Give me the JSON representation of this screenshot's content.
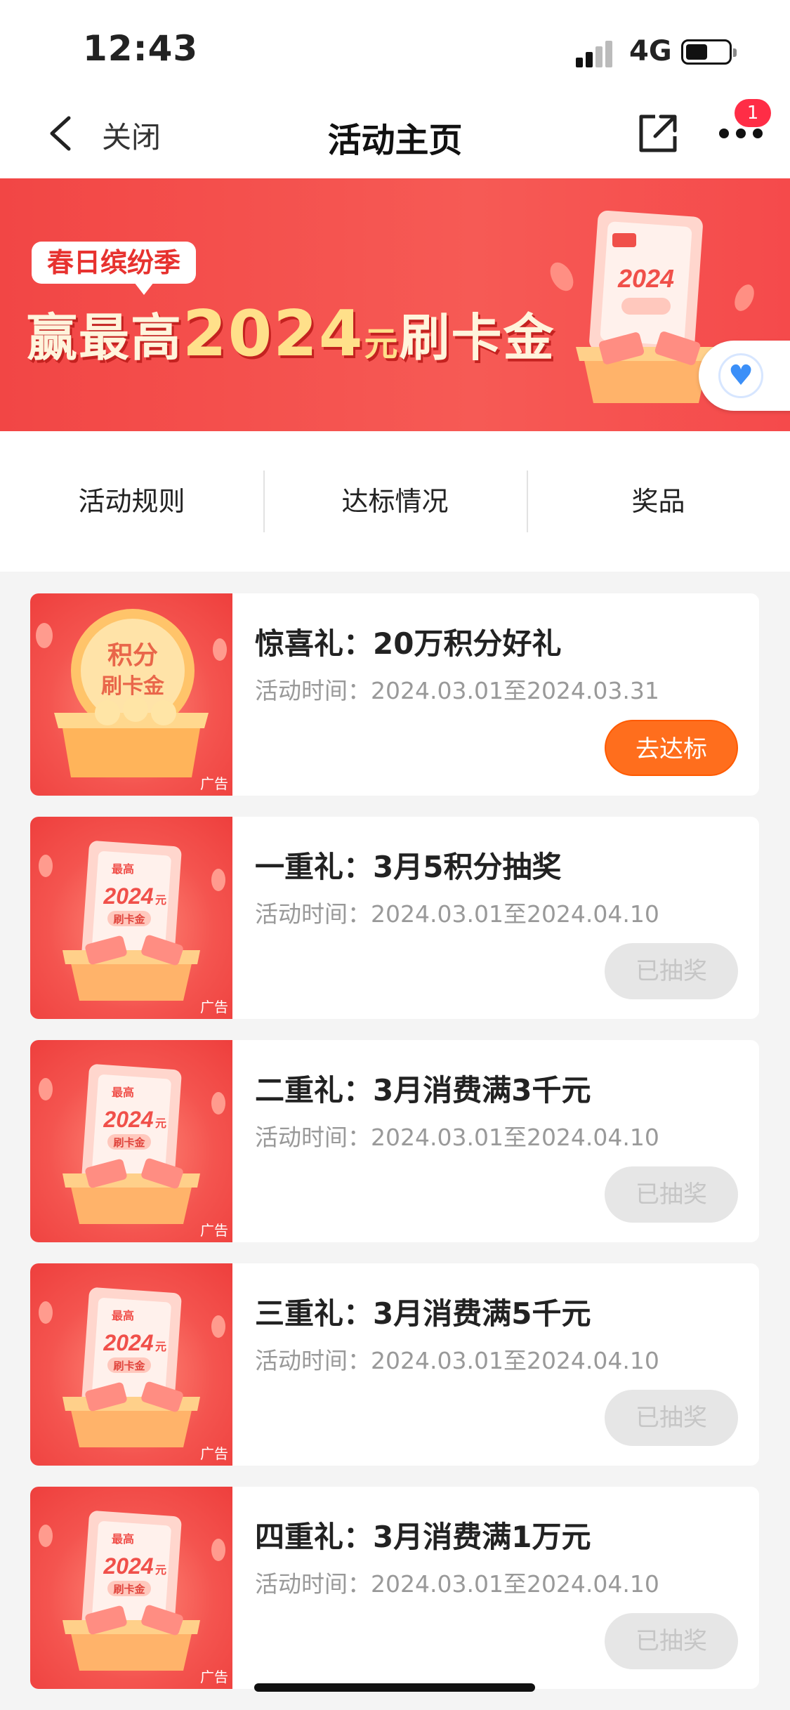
{
  "status_bar": {
    "time": "12:43",
    "network": "4G"
  },
  "nav": {
    "close_label": "关闭",
    "title": "活动主页",
    "badge_count": "1"
  },
  "banner": {
    "tag": "春日缤纷季",
    "headline_prefix": "赢最高",
    "headline_amount": "2024",
    "headline_unit": "元",
    "headline_suffix": "刷卡金",
    "ad_label": "广告"
  },
  "tabs": [
    "活动规则",
    "达标情况",
    "奖品"
  ],
  "colors": {
    "brand_red": "#f24645",
    "action_orange": "#ff6e1d",
    "disabled_gray": "#e6e6e6"
  },
  "activities": [
    {
      "title": "惊喜礼：20万积分好礼",
      "date": "活动时间：2024.03.01至2024.03.31",
      "button": "去达标",
      "state": "active",
      "thumb": "points-coin-chest",
      "ad": "广告"
    },
    {
      "title": "一重礼：3月5积分抽奖",
      "date": "活动时间：2024.03.01至2024.04.10",
      "button": "已抽奖",
      "state": "done",
      "thumb": "2024-card-chest",
      "ad": "广告"
    },
    {
      "title": "二重礼：3月消费满3千元",
      "date": "活动时间：2024.03.01至2024.04.10",
      "button": "已抽奖",
      "state": "done",
      "thumb": "2024-card-chest",
      "ad": "广告"
    },
    {
      "title": "三重礼：3月消费满5千元",
      "date": "活动时间：2024.03.01至2024.04.10",
      "button": "已抽奖",
      "state": "done",
      "thumb": "2024-card-chest",
      "ad": "广告"
    },
    {
      "title": "四重礼：3月消费满1万元",
      "date": "活动时间：2024.03.01至2024.04.10",
      "button": "已抽奖",
      "state": "done",
      "thumb": "2024-card-chest",
      "ad": "广告"
    }
  ],
  "thumb_text": {
    "coin_line1": "积分",
    "coin_line2": "刷卡金",
    "card_top": "最高",
    "card_amount": "2024",
    "card_unit": "元",
    "card_bottom": "刷卡金"
  }
}
